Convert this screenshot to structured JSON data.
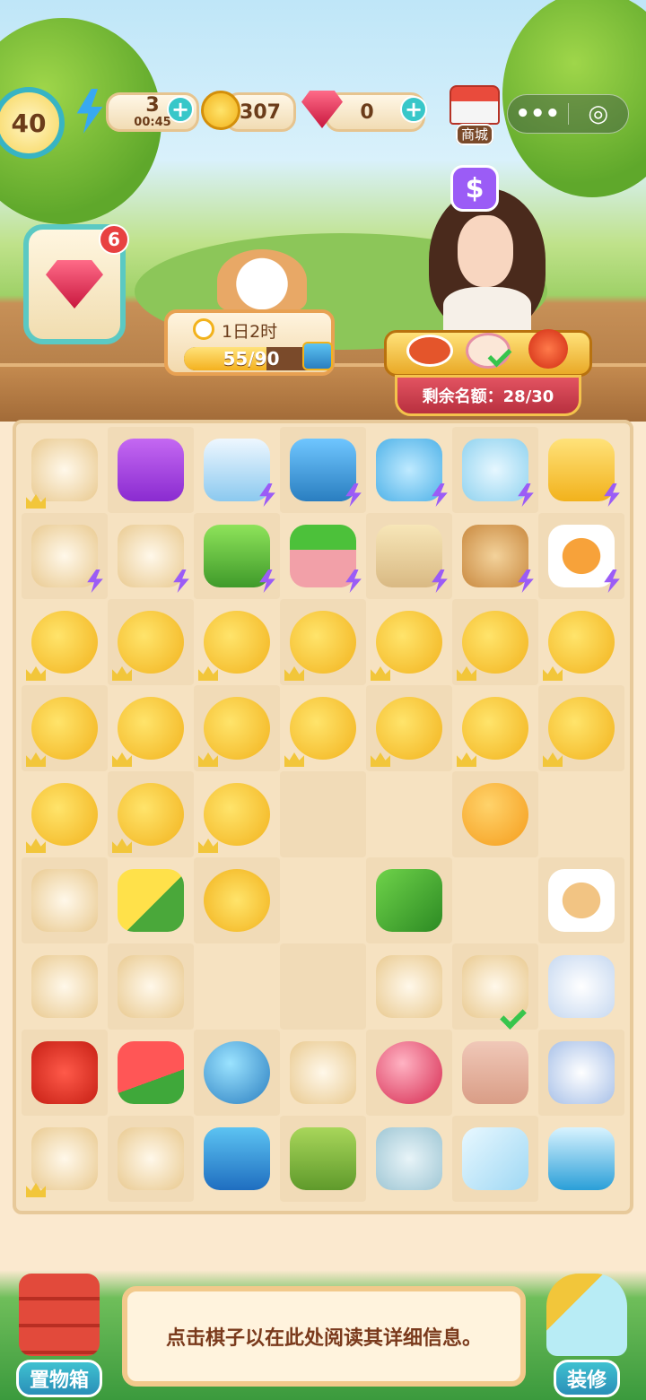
{
  "hud": {
    "level": "40",
    "energy": "3",
    "energy_timer": "00:45",
    "coins": "307",
    "gems": "0",
    "store_label": "商城",
    "menu_dots": "•••",
    "close_symbol": "◎"
  },
  "inventory_badge": "6",
  "event": {
    "time_left": "1日2时",
    "progress_text": "55/90",
    "progress_fraction": 0.61
  },
  "customer_bubble": "$",
  "order": {
    "quota_text": "剩余名额：28/30",
    "dishes": [
      "lobster",
      "cream-soup",
      "tomato"
    ]
  },
  "board": [
    [
      "dog-house-icon",
      "purple-chest-icon",
      "freezer-icon",
      "blue-fridge-icon",
      "fishbowl-icon",
      "fish-bag-icon",
      "bucket-icon"
    ],
    [
      "cherry-plate-icon",
      "tomato-basket-icon",
      "coffee-machine-icon",
      "vegetable-basket-icon",
      "corn-bag-icon",
      "clay-pot-icon",
      "soup-bowl-icon"
    ],
    [
      "coin-stack-icon",
      "coin-stack-icon",
      "coin-stack-icon",
      "coin-stack-icon",
      "coin-stack-icon",
      "coin-stack-icon",
      "coin-stack-icon"
    ],
    [
      "coin-stack-icon",
      "coin-stack-icon",
      "coin-stack-icon",
      "coin-stack-icon",
      "coin-stack-icon",
      "coin-stack-icon",
      "coin-stack-icon"
    ],
    [
      "coin-stack-icon",
      "coin-stack-icon",
      "coin-stack-icon",
      "",
      "",
      "balloon-icon",
      ""
    ],
    [
      "dough-roll-icon",
      "corn-icon",
      "coin-icon",
      "",
      "green-pepper-icon",
      "",
      "tea-cup-icon"
    ],
    [
      "oyster-plate-icon",
      "steamed-bun-icon",
      "",
      "",
      "tofu-dish-icon",
      "cream-soup-icon",
      "teapot-icon"
    ],
    [
      "strawberry-icon",
      "watermelon-icon",
      "blue-orb-icon",
      "tofu-cake-icon",
      "red-orb-icon",
      "paper-bag-icon",
      "tea-set-icon"
    ],
    [
      "ice-cream-bowl-icon",
      "fishing-rod-icon",
      "blue-chest-icon",
      "green-pitcher-icon",
      "porcelain-bowl-icon",
      "ice-cube-icon",
      "ice-bucket-icon"
    ]
  ],
  "info_text": "点击棋子以在此处阅读其详细信息。",
  "storage_label": "置物箱",
  "decorate_label": "装修"
}
